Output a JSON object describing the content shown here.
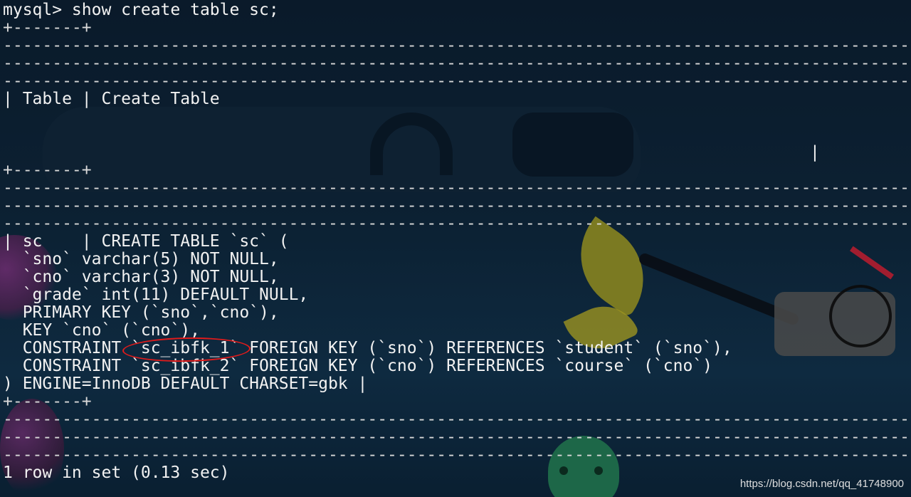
{
  "terminal": {
    "prompt_line": "mysql> show create table sc;",
    "separator_short": "+-------+",
    "separator_long": "--------------------------------------------------------------------------------------------------------------------------------",
    "separator_long_end": "--------------------------------------------------------------------------------------------------------------------------------------------------+",
    "header_row": "| Table | Create Table",
    "header_row_end": "|",
    "data_lines": [
      "| sc    | CREATE TABLE `sc` (",
      "  `sno` varchar(5) NOT NULL,",
      "  `cno` varchar(3) NOT NULL,",
      "  `grade` int(11) DEFAULT NULL,",
      "  PRIMARY KEY (`sno`,`cno`),",
      "  KEY `cno` (`cno`),",
      "  CONSTRAINT `sc_ibfk_1` FOREIGN KEY (`sno`) REFERENCES `student` (`sno`),",
      "  CONSTRAINT `sc_ibfk_2` FOREIGN KEY (`cno`) REFERENCES `course` (`cno`)",
      ") ENGINE=InnoDB DEFAULT CHARSET=gbk |"
    ],
    "result_line": "1 row in set (0.13 sec)"
  },
  "watermark": "https://blog.csdn.net/qq_41748900",
  "colors": {
    "text": "#f2f2f2",
    "annotation": "#e11b1b"
  }
}
